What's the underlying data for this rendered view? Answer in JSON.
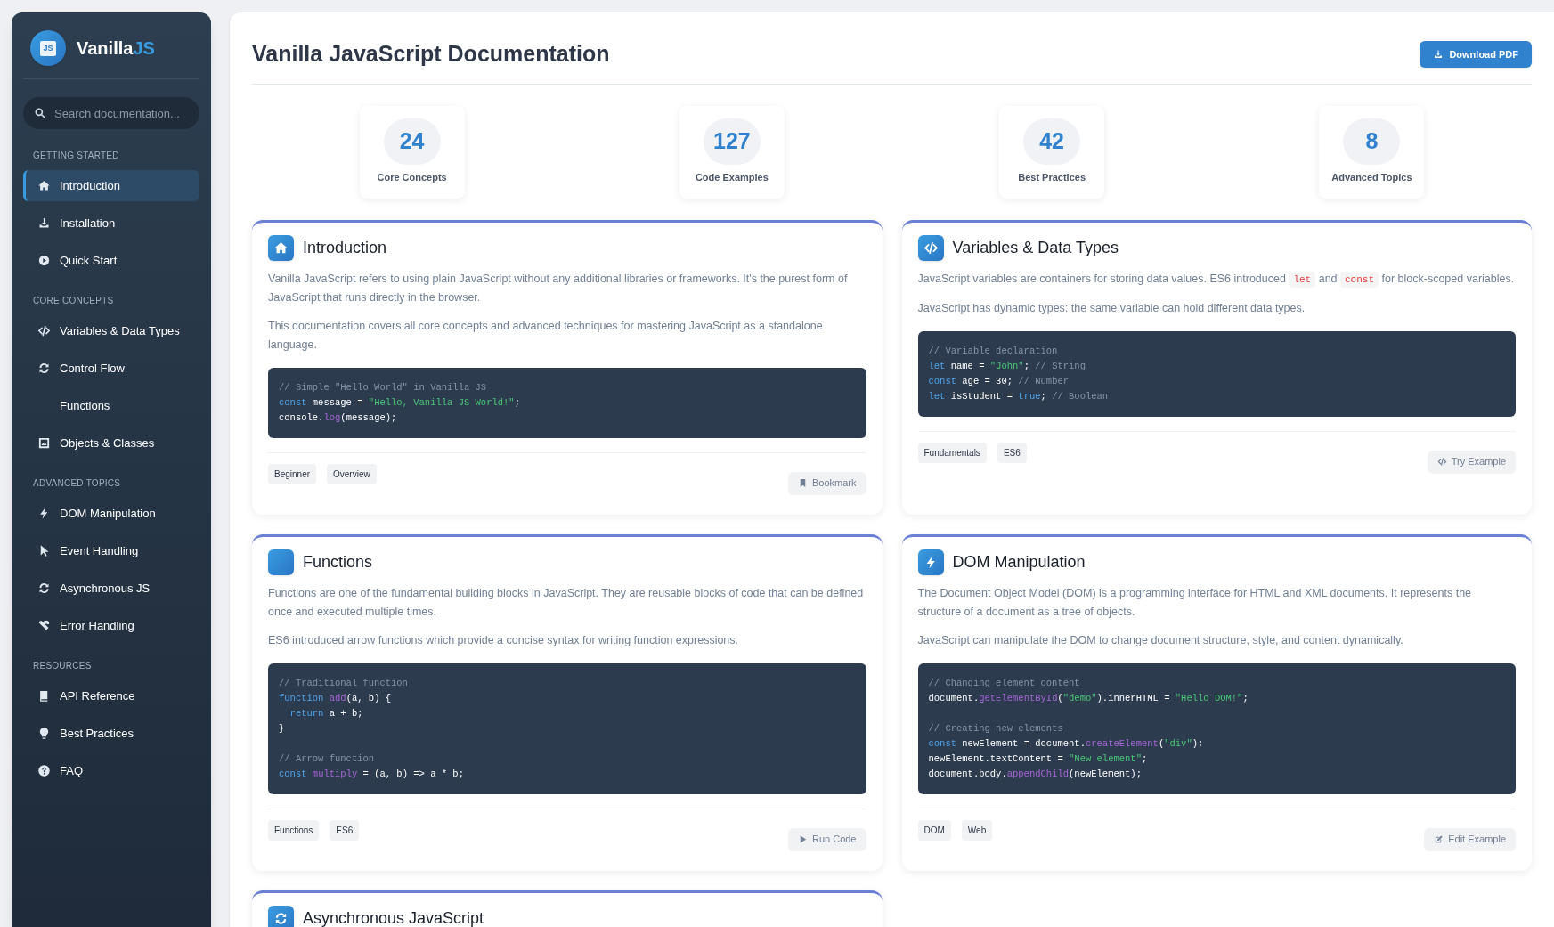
{
  "sidebar": {
    "logo": {
      "badge": "JS",
      "name": "Vanilla",
      "accent": "JS"
    },
    "search": {
      "placeholder": "Search documentation..."
    },
    "sections": [
      {
        "heading": "GETTING STARTED",
        "items": [
          {
            "label": "Introduction",
            "kind": "home",
            "selected": true
          },
          {
            "label": "Installation",
            "kind": "download",
            "selected": false
          },
          {
            "label": "Quick Start",
            "kind": "play",
            "selected": false
          }
        ]
      },
      {
        "heading": "CORE CONCEPTS",
        "items": [
          {
            "label": "Variables & Data Types",
            "kind": "code",
            "selected": false
          },
          {
            "label": "Control Flow",
            "kind": "sync",
            "selected": false
          },
          {
            "label": "Functions",
            "selected": false
          },
          {
            "label": "Objects & Classes",
            "kind": "image",
            "selected": false
          }
        ]
      },
      {
        "heading": "ADVANCED TOPICS",
        "items": [
          {
            "label": "DOM Manipulation",
            "kind": "bolt",
            "selected": false
          },
          {
            "label": "Event Handling",
            "kind": "pointer",
            "selected": false
          },
          {
            "label": "Asynchronous JS",
            "kind": "sync",
            "selected": false
          },
          {
            "label": "Error Handling",
            "kind": "tools",
            "selected": false
          }
        ]
      },
      {
        "heading": "RESOURCES",
        "items": [
          {
            "label": "API Reference",
            "kind": "book",
            "selected": false
          },
          {
            "label": "Best Practices",
            "kind": "bulb",
            "selected": false
          },
          {
            "label": "FAQ",
            "kind": "question",
            "selected": false
          }
        ]
      }
    ]
  },
  "header": {
    "title": "Vanilla JavaScript Documentation",
    "button": "Download PDF"
  },
  "stats": [
    {
      "value": "24",
      "label": "Core Concepts"
    },
    {
      "value": "127",
      "label": "Code Examples"
    },
    {
      "value": "42",
      "label": "Best Practices"
    },
    {
      "value": "8",
      "label": "Advanced Topics"
    }
  ],
  "cards": [
    {
      "title": "Introduction",
      "kind": "home",
      "paragraphs": [
        [
          {
            "kind": "text",
            "text": "Vanilla JavaScript refers to using plain JavaScript without any additional libraries or frameworks. It's the purest form of JavaScript that runs directly in the browser."
          }
        ],
        [
          {
            "kind": "text",
            "text": "This documentation covers all core concepts and advanced techniques for mastering JavaScript as a standalone language."
          }
        ]
      ],
      "code": [
        {
          "tokens": [
            {
              "kind": "comment",
              "text": "// Simple \"Hello World\" in Vanilla JS"
            }
          ]
        },
        {
          "tokens": [
            {
              "kind": "keyword",
              "text": "const"
            },
            {
              "kind": "plain",
              "text": " message = "
            },
            {
              "kind": "string",
              "text": "\"Hello, Vanilla JS World!\""
            },
            {
              "kind": "plain",
              "text": ";"
            }
          ]
        },
        {
          "tokens": [
            {
              "kind": "plain",
              "text": "console."
            },
            {
              "kind": "func",
              "text": "log"
            },
            {
              "kind": "plain",
              "text": "(message);"
            }
          ]
        }
      ],
      "tags": [
        "Beginner",
        "Overview"
      ],
      "action": {
        "label": "Bookmark",
        "kind": "bookmark"
      }
    },
    {
      "title": "Variables & Data Types",
      "kind": "code",
      "paragraphs": [
        [
          {
            "kind": "text",
            "text": "JavaScript variables are containers for storing data values. ES6 introduced "
          },
          {
            "kind": "code",
            "text": "let"
          },
          {
            "kind": "text",
            "text": " and "
          },
          {
            "kind": "code",
            "text": "const"
          },
          {
            "kind": "text",
            "text": " for block-scoped variables."
          }
        ],
        [
          {
            "kind": "text",
            "text": "JavaScript has dynamic types: the same variable can hold different data types."
          }
        ]
      ],
      "code": [
        {
          "tokens": [
            {
              "kind": "comment",
              "text": "// Variable declaration"
            }
          ]
        },
        {
          "tokens": [
            {
              "kind": "keyword",
              "text": "let"
            },
            {
              "kind": "plain",
              "text": " name = "
            },
            {
              "kind": "string",
              "text": "\"John\""
            },
            {
              "kind": "plain",
              "text": "; "
            },
            {
              "kind": "comment",
              "text": "// String"
            }
          ]
        },
        {
          "tokens": [
            {
              "kind": "keyword",
              "text": "const"
            },
            {
              "kind": "plain",
              "text": " age = 30; "
            },
            {
              "kind": "comment",
              "text": "// Number"
            }
          ]
        },
        {
          "tokens": [
            {
              "kind": "keyword",
              "text": "let"
            },
            {
              "kind": "plain",
              "text": " isStudent = "
            },
            {
              "kind": "keyword",
              "text": "true"
            },
            {
              "kind": "plain",
              "text": "; "
            },
            {
              "kind": "comment",
              "text": "// Boolean"
            }
          ]
        }
      ],
      "tags": [
        "Fundamentals",
        "ES6"
      ],
      "action": {
        "label": "Try Example",
        "kind": "code"
      }
    },
    {
      "title": "Functions",
      "paragraphs": [
        [
          {
            "kind": "text",
            "text": "Functions are one of the fundamental building blocks in JavaScript. They are reusable blocks of code that can be defined once and executed multiple times."
          }
        ],
        [
          {
            "kind": "text",
            "text": "ES6 introduced arrow functions which provide a concise syntax for writing function expressions."
          }
        ]
      ],
      "code": [
        {
          "tokens": [
            {
              "kind": "comment",
              "text": "// Traditional function"
            }
          ]
        },
        {
          "tokens": [
            {
              "kind": "keyword",
              "text": "function"
            },
            {
              "kind": "func",
              "text": "add",
              "space_before": true
            },
            {
              "kind": "plain",
              "text": "(a, b) {"
            }
          ]
        },
        {
          "indent": true,
          "tokens": [
            {
              "kind": "keyword",
              "text": "return"
            },
            {
              "kind": "plain",
              "text": " a + b;"
            }
          ]
        },
        {
          "tokens": [
            {
              "kind": "plain",
              "text": "}"
            }
          ]
        },
        {
          "gap_before": true,
          "tokens": [
            {
              "kind": "comment",
              "text": "// Arrow function"
            }
          ]
        },
        {
          "tokens": [
            {
              "kind": "keyword",
              "text": "const"
            },
            {
              "kind": "func",
              "text": "multiply",
              "space_before": true
            },
            {
              "kind": "plain",
              "text": " = (a, b) => a * b;"
            }
          ]
        }
      ],
      "tags": [
        "Functions",
        "ES6"
      ],
      "action": {
        "label": "Run Code",
        "kind": "triangle"
      }
    },
    {
      "title": "DOM Manipulation",
      "kind": "bolt",
      "paragraphs": [
        [
          {
            "kind": "text",
            "text": "The Document Object Model (DOM) is a programming interface for HTML and XML documents. It represents the structure of a document as a tree of objects."
          }
        ],
        [
          {
            "kind": "text",
            "text": "JavaScript can manipulate the DOM to change document structure, style, and content dynamically."
          }
        ]
      ],
      "code": [
        {
          "tokens": [
            {
              "kind": "comment",
              "text": "// Changing element content"
            }
          ]
        },
        {
          "tokens": [
            {
              "kind": "plain",
              "text": "document."
            },
            {
              "kind": "func",
              "text": "getElementById"
            },
            {
              "kind": "plain",
              "text": "("
            },
            {
              "kind": "string",
              "text": "\"demo\""
            },
            {
              "kind": "plain",
              "text": ").innerHTML = "
            },
            {
              "kind": "string",
              "text": "\"Hello DOM!\""
            },
            {
              "kind": "plain",
              "text": ";"
            }
          ]
        },
        {
          "gap_before": true,
          "tokens": [
            {
              "kind": "comment",
              "text": "// Creating new elements"
            }
          ]
        },
        {
          "tokens": [
            {
              "kind": "keyword",
              "text": "const"
            },
            {
              "kind": "plain",
              "text": " newElement = document."
            },
            {
              "kind": "func",
              "text": "createElement"
            },
            {
              "kind": "plain",
              "text": "("
            },
            {
              "kind": "string",
              "text": "\"div\""
            },
            {
              "kind": "plain",
              "text": ");"
            }
          ]
        },
        {
          "tokens": [
            {
              "kind": "plain",
              "text": "newElement.textContent = "
            },
            {
              "kind": "string",
              "text": "\"New element\""
            },
            {
              "kind": "plain",
              "text": ";"
            }
          ]
        },
        {
          "tokens": [
            {
              "kind": "plain",
              "text": "document.body."
            },
            {
              "kind": "func",
              "text": "appendChild"
            },
            {
              "kind": "plain",
              "text": "(newElement);"
            }
          ]
        }
      ],
      "tags": [
        "DOM",
        "Web"
      ],
      "action": {
        "label": "Edit Example",
        "kind": "edit"
      }
    },
    {
      "title": "Asynchronous JavaScript",
      "kind": "sync"
    }
  ]
}
